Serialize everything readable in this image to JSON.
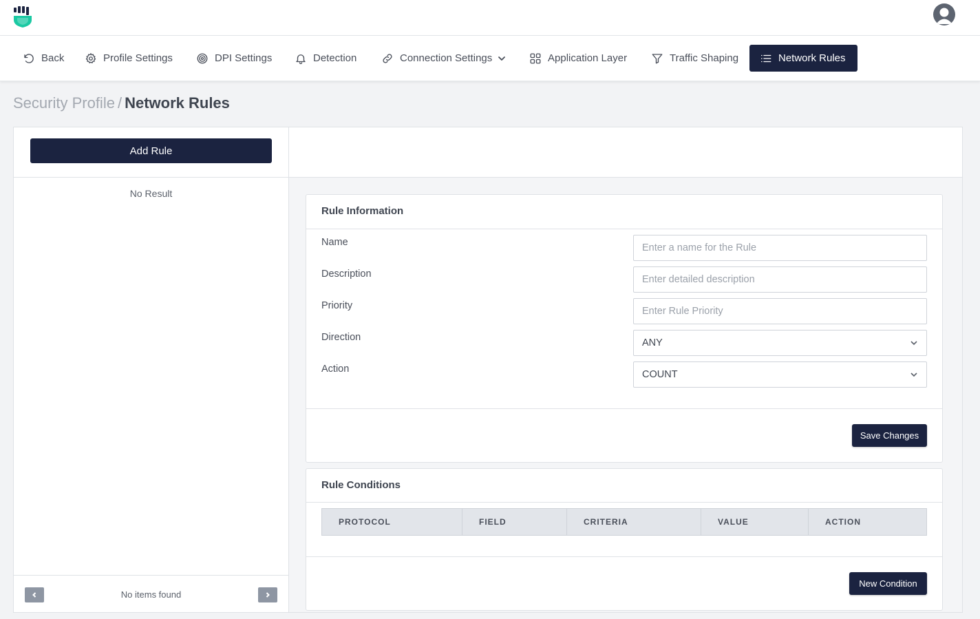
{
  "header": {
    "logo_icon": "shield-fist-icon",
    "logo_color": "#1bc9a3",
    "avatar_icon": "user-avatar-icon"
  },
  "nav": {
    "items": [
      {
        "label": "Back",
        "icon": "undo-icon"
      },
      {
        "label": "Profile Settings",
        "icon": "gear-icon"
      },
      {
        "label": "DPI Settings",
        "icon": "target-icon"
      },
      {
        "label": "Detection",
        "icon": "bell-icon"
      },
      {
        "label": "Connection Settings",
        "icon": "link-icon"
      },
      {
        "label": "Application Layer",
        "icon": "grid-icon"
      },
      {
        "label": "Traffic Shaping",
        "icon": "filter-icon"
      },
      {
        "label": "Network Rules",
        "icon": "list-icon",
        "active": true
      }
    ],
    "active_color": "#1b2340"
  },
  "breadcrumb": {
    "parent": "Security Profile",
    "separator": "/",
    "current": "Network Rules"
  },
  "rules_list": {
    "add_rule_label": "Add Rule",
    "empty_text": "No Result",
    "pager_text": "No items found"
  },
  "rule_info": {
    "title": "Rule Information",
    "fields": {
      "name": {
        "label": "Name",
        "placeholder": "Enter a name for the Rule"
      },
      "description": {
        "label": "Description",
        "placeholder": "Enter detailed description"
      },
      "priority": {
        "label": "Priority",
        "placeholder": "Enter Rule Priority"
      },
      "direction": {
        "label": "Direction",
        "value": "ANY"
      },
      "action": {
        "label": "Action",
        "value": "COUNT"
      }
    },
    "save_label": "Save Changes"
  },
  "rule_conditions": {
    "title": "Rule Conditions",
    "columns": [
      "PROTOCOL",
      "FIELD",
      "CRITERIA",
      "VALUE",
      "ACTION"
    ],
    "new_condition_label": "New Condition"
  }
}
